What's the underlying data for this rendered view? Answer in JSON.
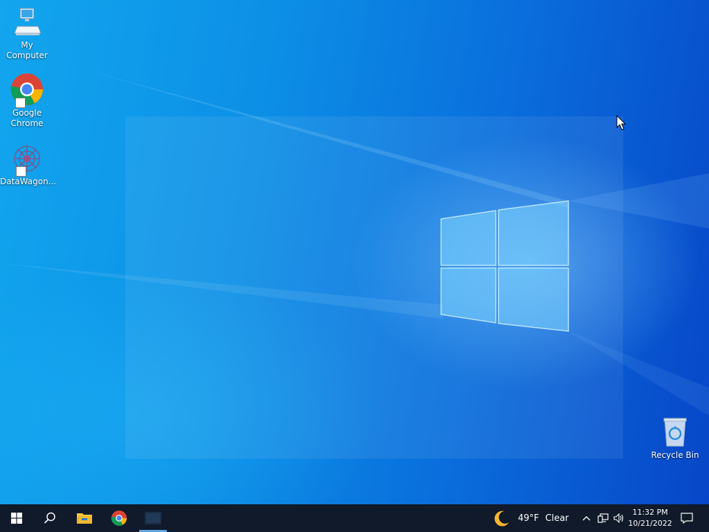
{
  "desktop": {
    "icons": [
      {
        "label": "My Computer",
        "icon": "computer-icon",
        "shortcut": false
      },
      {
        "label": "Google\nChrome",
        "icon": "chrome-icon",
        "shortcut": true
      },
      {
        "label": "DataWagon...",
        "icon": "datawagon-icon",
        "shortcut": true
      },
      {
        "label": "Recycle Bin",
        "icon": "recycle-bin-icon",
        "shortcut": false
      }
    ]
  },
  "taskbar": {
    "start_icon": "windows-logo-icon",
    "search_icon": "search-icon",
    "pinned": [
      "file-explorer-icon",
      "chrome-icon",
      "app-icon"
    ],
    "weather": {
      "temp": "49°F",
      "condition": "Clear",
      "icon": "moon-icon"
    },
    "tray_icons": [
      "chevron-up-icon",
      "network-icon",
      "volume-icon"
    ],
    "clock": {
      "time": "11:32 PM",
      "date": "10/21/2022"
    },
    "notification_icon": "notification-icon"
  },
  "colors": {
    "taskbar": "#101a2a",
    "accent": "#5aa6e6",
    "wallpaper_left": "#12a6ee",
    "wallpaper_right": "#0746c8"
  }
}
